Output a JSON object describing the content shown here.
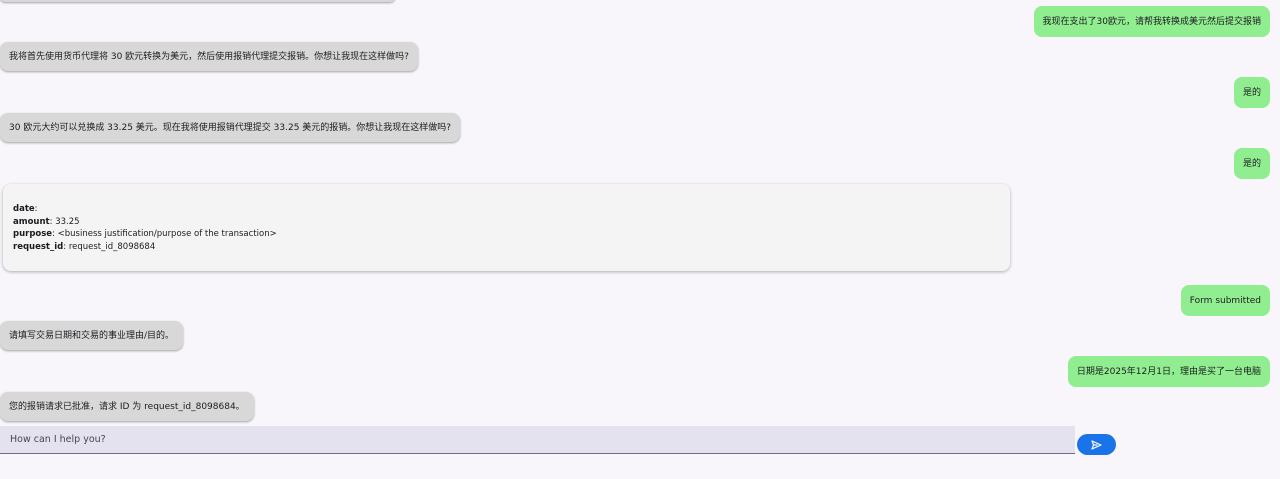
{
  "messages": {
    "user_1": "我现在支出了30欧元，请帮我转换成美元然后提交报销",
    "bot_1": "我将首先使用货币代理将 30 欧元转换为美元，然后使用报销代理提交报销。你想让我现在这样做吗?",
    "user_2": "是的",
    "bot_2": "30 欧元大约可以兑换成 33.25 美元。现在我将使用报销代理提交 33.25 美元的报销。你想让我现在这样做吗?",
    "user_3": "是的",
    "user_4": "Form submitted",
    "bot_3": "请填写交易日期和交易的事业理由/目的。",
    "user_5": "日期是2025年12月1日，理由是买了一台电脑",
    "bot_4": "您的报销请求已批准，请求 ID 为 request_id_8098684。"
  },
  "form": {
    "date_label": "date",
    "date_value": "",
    "amount_label": "amount",
    "amount_value": "33.25",
    "purpose_label": "purpose",
    "purpose_value": "<business justification/purpose of the transaction>",
    "request_id_label": "request_id",
    "request_id_value": "request_id_8098684"
  },
  "composer": {
    "placeholder": "How can I help you?",
    "send_icon": "send-icon"
  },
  "colors": {
    "background": "#f8f6fb",
    "bot_bubble": "#d8d8d8",
    "user_bubble": "#90ee90",
    "send_button": "#1a73e8",
    "input_background": "#e4e2ee"
  }
}
